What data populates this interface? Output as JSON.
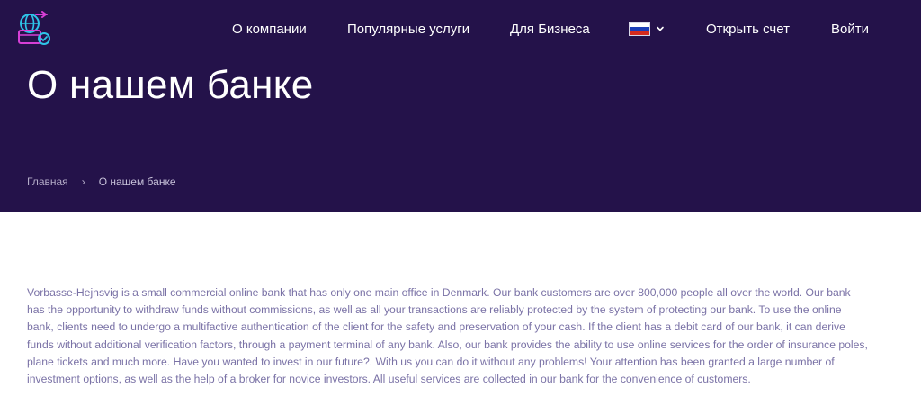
{
  "header": {
    "logo_name": "bank-logo",
    "nav": {
      "about": "О компании",
      "popular": "Популярные услуги",
      "business": "Для Бизнеса",
      "open_account": "Открыть счет",
      "login": "Войти"
    },
    "language": {
      "flag": "russia-flag-icon",
      "selected": "RU"
    }
  },
  "hero": {
    "title": "О нашем банке",
    "breadcrumb": {
      "home": "Главная",
      "separator": "›",
      "current": "О нашем банке"
    }
  },
  "content": {
    "paragraph": "Vorbasse-Hejnsvig is a small commercial online bank that has only one main office in Denmark. Our bank customers are over 800,000 people all over the world. Our bank has the opportunity to withdraw funds without commissions, as well as all your transactions are reliably protected by the system of protecting our bank. To use the online bank, clients need to undergo a multifactive authentication of the client for the safety and preservation of your cash. If the client has a debit card of our bank, it can derive funds without additional verification factors, through a payment terminal of any bank. Also, our bank provides the ability to use online services for the order of insurance poles, plane tickets and much more. Have you wanted to invest in our future?. With us you can do it without any problems! Your attention has been granted a large number of investment options, as well as the help of a broker for novice investors. All useful services are collected in our bank for the convenience of customers."
  },
  "colors": {
    "header_bg": "#24124a",
    "text_muted": "#7a72a6",
    "accent_pink": "#d63fd6",
    "accent_cyan": "#2ec4e8"
  }
}
